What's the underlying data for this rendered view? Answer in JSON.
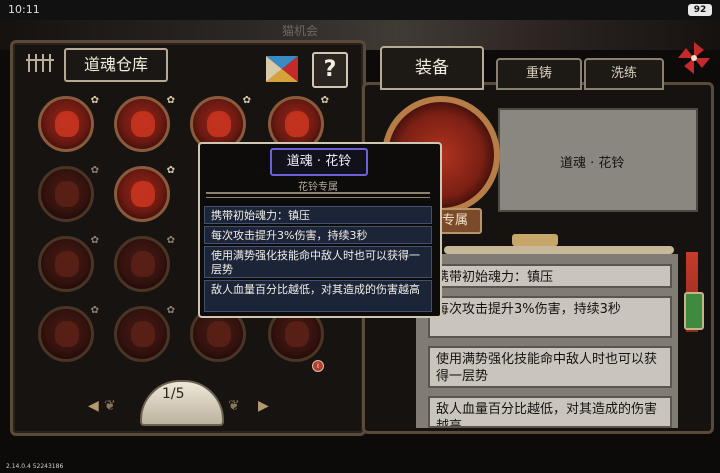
{
  "status_bar": {
    "time": "10:11",
    "battery": "92"
  },
  "scene_title": "猫机会",
  "storage": {
    "title": "道魂仓库",
    "help_label": "?",
    "page": "1/5",
    "prev_label": "◀",
    "next_label": "▶",
    "prev_ornament": "❦",
    "next_ornament": "❦",
    "slot_star": "✿",
    "info_dot": "i"
  },
  "tabs": {
    "equip": "装备",
    "recast": "重铸",
    "refine": "洗练"
  },
  "item": {
    "name": "道魂 · 花铃",
    "tooltip_name": "道魂 · 花铃",
    "exclusive": "花铃专属",
    "effects": [
      "携带初始魂力：镇压",
      "每次攻击提升3%伤害，持续3秒",
      "使用满势强化技能命中敌人时也可以获得一层势",
      "敌人血量百分比越低，对其造成的伤害越高"
    ],
    "effects_right": [
      "携带初始魂力：镇压",
      "每次攻击提升3%伤害，持续3秒",
      "使用满势强化技能命中敌人时也可以获得一层势",
      "敌人血量百分比越低，对其造成的伤害越高"
    ]
  },
  "version": "2.14.0.4 52243186",
  "colors": {
    "accent_red": "#c8341f",
    "gold": "#b67e46",
    "tooltip_title_border": "#6b62d8"
  },
  "icons": {
    "tassel": "tassel-icon",
    "puzzle": "puzzle-icon",
    "pinwheel": "pinwheel-icon",
    "help": "help-icon"
  }
}
